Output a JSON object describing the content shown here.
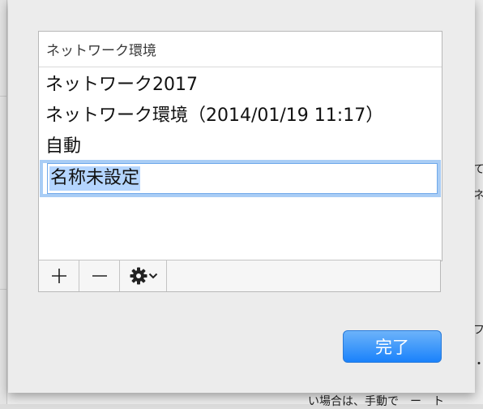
{
  "background": {
    "right_text": [
      "て",
      "ネ",
      "フ",
      "・"
    ],
    "bottom_text": "い場合は、手動で　ー　ト"
  },
  "sheet": {
    "list": {
      "header": "ネットワーク環境",
      "items": [
        {
          "label": "ネットワーク2017"
        },
        {
          "label": "ネットワーク環境（2014/01/19 11:17）"
        },
        {
          "label": "自動"
        }
      ],
      "editing_item": {
        "value": "名称未設定"
      }
    },
    "toolbar": {
      "add_icon": "plus-icon",
      "remove_icon": "minus-icon",
      "action_icon": "gear-icon"
    },
    "done_label": "完了"
  },
  "colors": {
    "accent": "#1a82fb",
    "selection": "#b4d5fe",
    "focus_ring": "#a9cdf5"
  }
}
